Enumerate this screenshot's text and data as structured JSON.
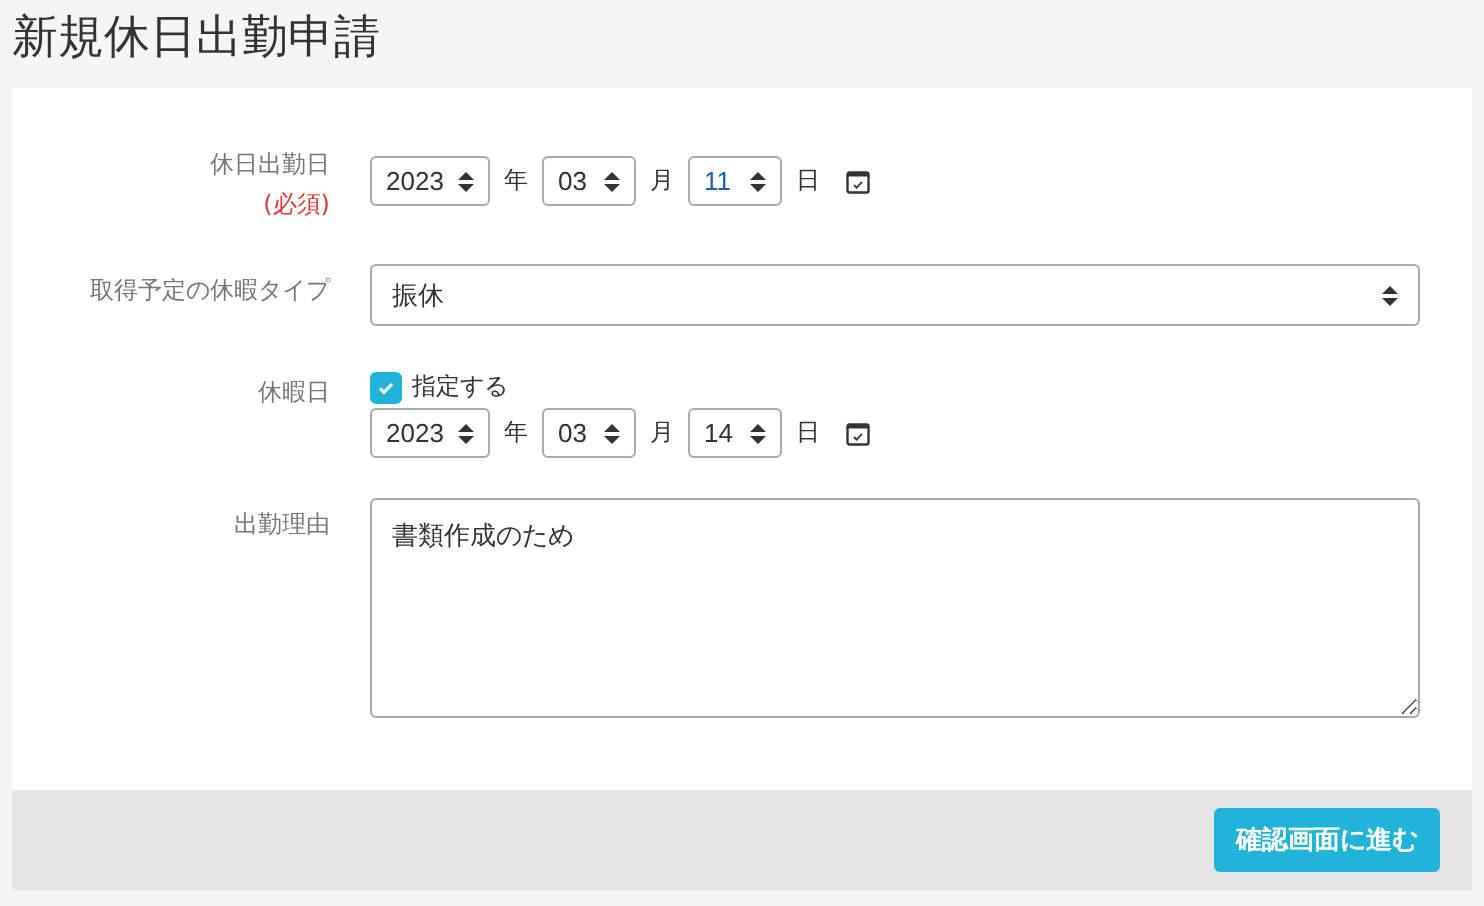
{
  "title": "新規休日出勤申請",
  "form": {
    "work_date": {
      "label": "休日出勤日",
      "required_note": "(必須)",
      "year": "2023",
      "year_unit": "年",
      "month": "03",
      "month_unit": "月",
      "day": "11",
      "day_unit": "日"
    },
    "leave_type": {
      "label": "取得予定の休暇タイプ",
      "value": "振休"
    },
    "leave_date": {
      "label": "休暇日",
      "checkbox_label": "指定する",
      "checked": true,
      "year": "2023",
      "year_unit": "年",
      "month": "03",
      "month_unit": "月",
      "day": "14",
      "day_unit": "日"
    },
    "reason": {
      "label": "出勤理由",
      "value": "書類作成のため"
    }
  },
  "submit_button": "確認画面に進む"
}
